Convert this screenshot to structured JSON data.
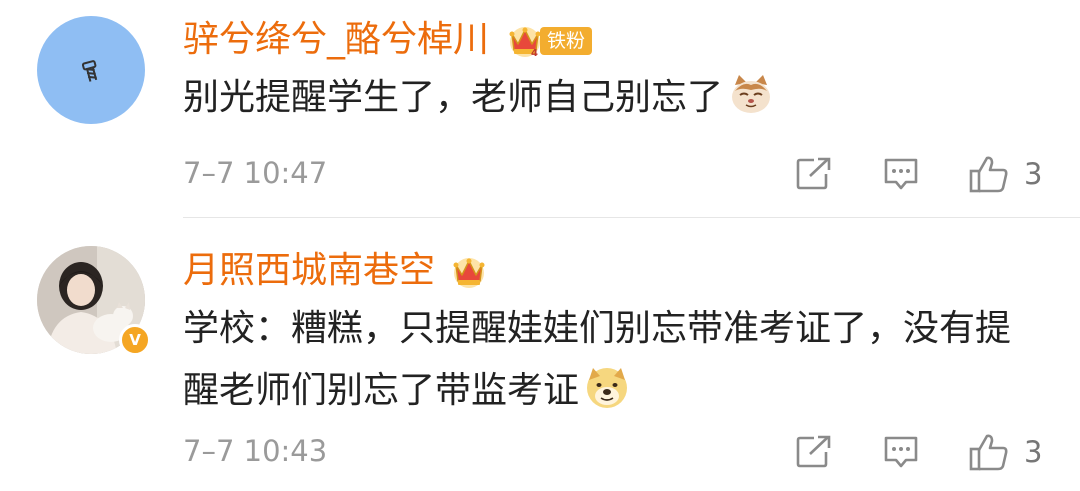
{
  "comments": [
    {
      "username": "骍兮绛兮_酪兮棹川",
      "badge": "铁粉",
      "content": "别光提醒学生了，老师自己别忘了",
      "emoji": "cat-face-emoji",
      "time": "7–7 10:47",
      "likes": "3"
    },
    {
      "username": "月照西城南巷空",
      "content": "学校：糟糕，只提醒娃娃们别忘带准考证了，没有提醒老师们别忘了带监考证",
      "emoji": "doge-emoji",
      "time": "7–7 10:43",
      "likes": "3",
      "verified": "V"
    }
  ],
  "colors": {
    "username": "#ec6c0c",
    "badge_bg": "#f3ad2f",
    "avatar1_bg": "#8fbef3",
    "time": "#9a9a9a"
  },
  "icons": [
    "share-icon",
    "reply-icon",
    "like-icon",
    "crown-icon"
  ]
}
